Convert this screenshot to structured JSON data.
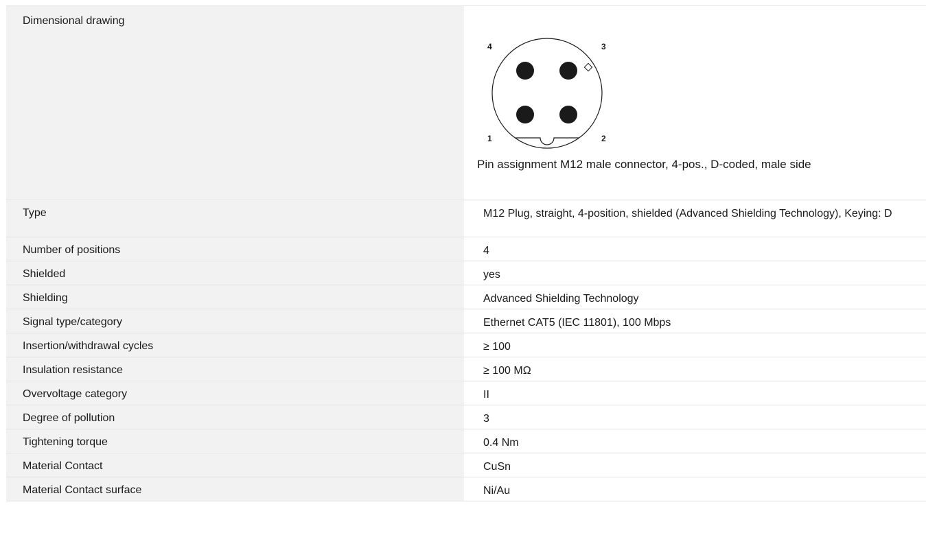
{
  "drawing": {
    "label": "Dimensional drawing",
    "caption": "Pin assignment M12 male connector, 4-pos., D-coded, male side",
    "pins": [
      "1",
      "2",
      "3",
      "4"
    ]
  },
  "specs": [
    {
      "label": "Type",
      "value": "M12 Plug, straight, 4-position, shielded (Advanced Shielding Technology), Keying: D"
    },
    {
      "label": "Number of positions",
      "value": "4"
    },
    {
      "label": "Shielded",
      "value": "yes"
    },
    {
      "label": "Shielding",
      "value": "Advanced Shielding Technology"
    },
    {
      "label": "Signal type/category",
      "value": "Ethernet CAT5 (IEC 11801), 100 Mbps"
    },
    {
      "label": "Insertion/withdrawal cycles",
      "value": "≥ 100"
    },
    {
      "label": "Insulation resistance",
      "value": "≥ 100 MΩ"
    },
    {
      "label": "Overvoltage category",
      "value": "II"
    },
    {
      "label": "Degree of pollution",
      "value": "3"
    },
    {
      "label": "Tightening torque",
      "value": "0.4 Nm"
    },
    {
      "label": "Material Contact",
      "value": "CuSn"
    },
    {
      "label": "Material Contact surface",
      "value": "Ni/Au"
    }
  ]
}
